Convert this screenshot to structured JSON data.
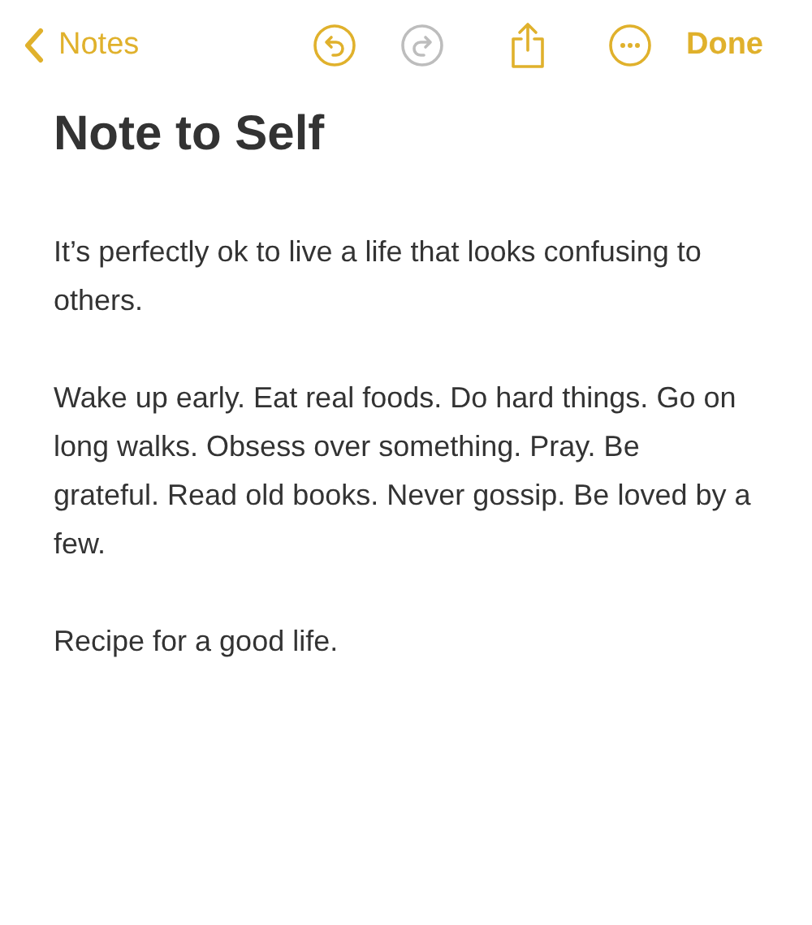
{
  "toolbar": {
    "back": "Notes",
    "undo_disabled": false,
    "redo_disabled": true,
    "done": "Done"
  },
  "note": {
    "title": "Note to Self",
    "paragraphs": [
      "It’s perfectly ok to live a life that looks confusing to others.",
      "Wake up early. Eat real foods. Do hard things. Go on long walks. Obsess over something. Pray. Be grateful. Read old books. Never gossip. Be loved by a few.",
      "Recipe for a good life."
    ]
  }
}
